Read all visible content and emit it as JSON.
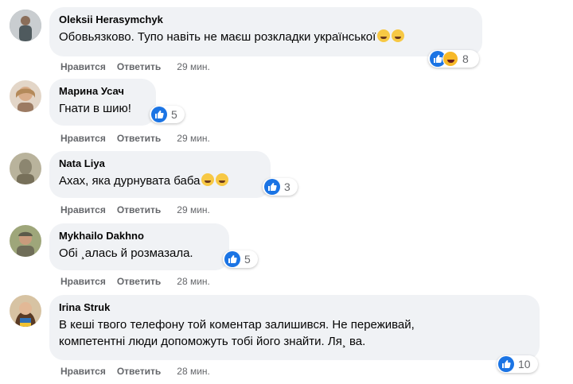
{
  "comments": [
    {
      "author": "Oleksii Herasymchyk",
      "text": "Обовьязково. Тупо навіть не маєш розкладки української",
      "reaction_count": "8",
      "like": "Нравится",
      "reply": "Ответить",
      "time": "29 мин.",
      "avatar_color": "#7d8a8f"
    },
    {
      "author": "Марина Усач",
      "text": "Гнати в шию!",
      "reaction_count": "5",
      "like": "Нравится",
      "reply": "Ответить",
      "time": "29 мин.",
      "avatar_color": "#c9a27a"
    },
    {
      "author": "Nata Liya",
      "text": "Ахах, яка дурнувата баба",
      "reaction_count": "3",
      "like": "Нравится",
      "reply": "Ответить",
      "time": "29 мин.",
      "avatar_color": "#a9a58f"
    },
    {
      "author": "Mykhailo Dakhno",
      "text": "Обі ¸алась й розмазала.",
      "reaction_count": "5",
      "like": "Нравится",
      "reply": "Ответить",
      "time": "28 мин.",
      "avatar_color": "#8b8a6f"
    },
    {
      "author": "Irina Struk",
      "text_line1": "В кеші твого телефону той коментар залишився. Не переживай,",
      "text_line2": "компетентні люди допоможуть тобі його знайти. Ля¸ ва.",
      "reaction_count": "10",
      "like": "Нравится",
      "reply": "Ответить",
      "time": "28 мин.",
      "avatar_color": "#8c6a4f"
    }
  ],
  "colors": {
    "bubble": "#f0f2f5",
    "like_blue": "#1b74e4",
    "meta_gray": "#65676b"
  }
}
